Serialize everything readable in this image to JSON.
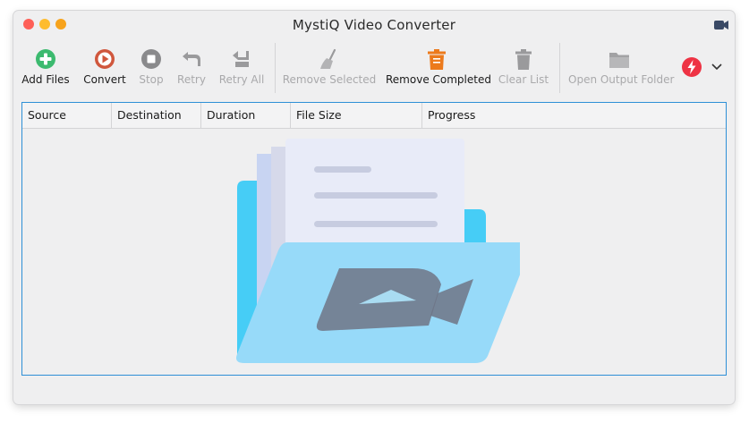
{
  "window": {
    "title": "MystiQ Video Converter"
  },
  "toolbar": {
    "buttons": [
      {
        "label": "Add Files",
        "icon": "add-circle-icon",
        "enabled": true
      },
      {
        "label": "Convert",
        "icon": "play-circle-icon",
        "enabled": true
      },
      {
        "label": "Stop",
        "icon": "stop-circle-icon",
        "enabled": false
      },
      {
        "label": "Retry",
        "icon": "retry-arrow-icon",
        "enabled": false
      },
      {
        "label": "Retry All",
        "icon": "retry-all-icon",
        "enabled": false
      },
      {
        "label": "Remove Selected",
        "icon": "broom-icon",
        "enabled": false
      },
      {
        "label": "Remove Completed",
        "icon": "trash-icon",
        "enabled": true
      },
      {
        "label": "Clear List",
        "icon": "trash-icon",
        "enabled": false
      },
      {
        "label": "Open Output Folder",
        "icon": "folder-icon",
        "enabled": false
      }
    ],
    "extra_icons": [
      "lightning-icon",
      "chevron-down-icon"
    ]
  },
  "table": {
    "columns": [
      "Source",
      "Destination",
      "Duration",
      "File Size",
      "Progress"
    ]
  },
  "colors": {
    "accent": "#2d8fd6",
    "add_green": "#3cba6f",
    "convert_red": "#d0573d",
    "trash_orange": "#ec7a1c",
    "lightning_red": "#ee3344"
  }
}
